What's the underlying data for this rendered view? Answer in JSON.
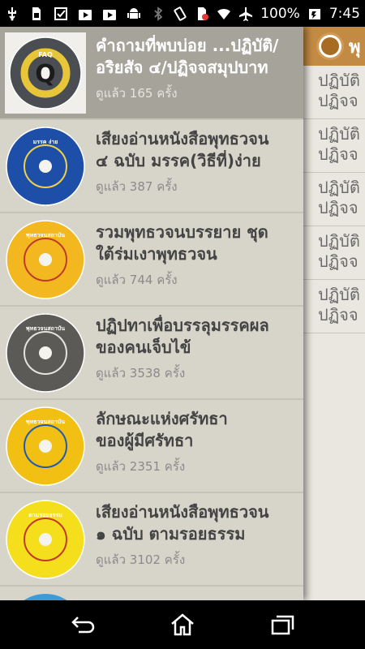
{
  "status_bar": {
    "battery": "100%",
    "time": "7:45",
    "icons": [
      "usb-icon",
      "sim-icon",
      "checkbox-icon",
      "play-store-icon",
      "play-store-icon",
      "android-icon",
      "bluetooth-icon",
      "vibrate-icon",
      "no-sim-icon",
      "wifi-icon",
      "airplane-icon",
      "battery-icon"
    ]
  },
  "behind_panel": {
    "header_title": "พุ",
    "rows": [
      {
        "line1": "ปฏิบัติ",
        "line2": "ปฏิจจ"
      },
      {
        "line1": "ปฏิบัติ",
        "line2": "ปฏิจจ"
      },
      {
        "line1": "ปฏิบัติ",
        "line2": "ปฏิจจ"
      },
      {
        "line1": "ปฏิบัติ",
        "line2": "ปฏิจจ"
      },
      {
        "line1": "ปฏิบัติ",
        "line2": "ปฏิจจ"
      }
    ]
  },
  "items": [
    {
      "title1": "คำถามที่พบบ่อย ...ปฏิบัติ/",
      "title2": "อริยสัจ ๔/ปฏิจจสมุปบาท",
      "views": "ดูแล้ว 165 ครั้ง",
      "disc_label": "FAQ",
      "disc_letter": "Q",
      "disc_color": "#4a4d52",
      "accent": "#e8c63a"
    },
    {
      "title1": "เสียงอ่านหนังสือพุทธวจน",
      "title2": "๔ ฉบับ มรรค(วิธีที่)ง่าย",
      "views": "ดูแล้ว 387 ครั้ง",
      "disc_label": "มรรค ง่าย",
      "disc_letter": "",
      "disc_color": "#1d4fa8",
      "accent": "#f1d14a"
    },
    {
      "title1": "รวมพุทธวจนบรรยาย ชุด",
      "title2": "ใต้ร่มเงาพุทธวจน",
      "views": "ดูแล้ว 744 ครั้ง",
      "disc_label": "พุทธวจนสถาบัน",
      "disc_letter": "",
      "disc_color": "#f3b81f",
      "accent": "#c0392b"
    },
    {
      "title1": "ปฏิปทาเพื่อบรรลุมรรคผล",
      "title2": "ของคนเจ็บไข้",
      "views": "ดูแล้ว 3538 ครั้ง",
      "disc_label": "พุทธวจนสถาบัน",
      "disc_letter": "",
      "disc_color": "#5b5a57",
      "accent": "#e5e3dd"
    },
    {
      "title1": "ลักษณะแห่งศรัทธา",
      "title2": "ของผู้มีศรัทธา",
      "views": "ดูแล้ว 2351 ครั้ง",
      "disc_label": "พุทธวจนสถาบัน",
      "disc_letter": "",
      "disc_color": "#f2c012",
      "accent": "#1f5bb5"
    },
    {
      "title1": "เสียงอ่านหนังสือพุทธวจน",
      "title2": "๑ ฉบับ ตามรอยธรรม",
      "views": "ดูแล้ว 3102 ครั้ง",
      "disc_label": "ตามรอยธรรม",
      "disc_letter": "",
      "disc_color": "#f5de1b",
      "accent": "#c0392b"
    }
  ],
  "nav_bar": {
    "back": "back-icon",
    "home": "home-icon",
    "recents": "recents-icon"
  }
}
